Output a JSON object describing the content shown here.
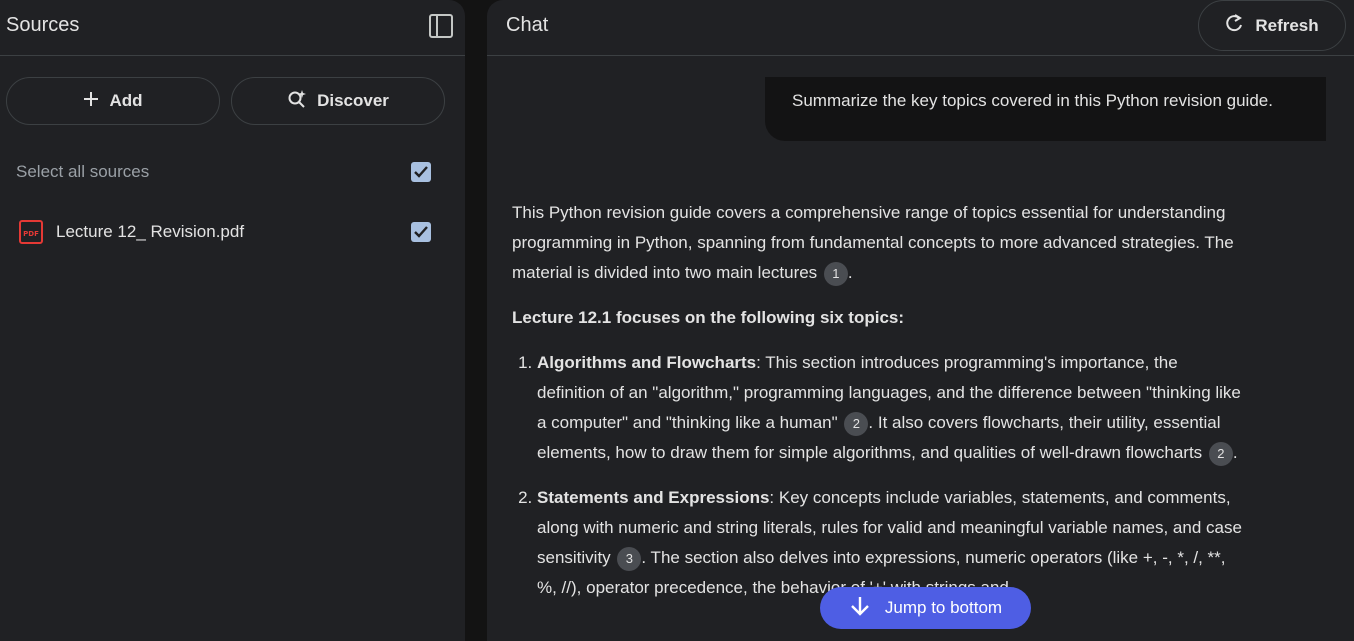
{
  "sources": {
    "title": "Sources",
    "add_label": "Add",
    "discover_label": "Discover",
    "select_all_label": "Select all sources",
    "select_all_checked": true,
    "items": [
      {
        "name": "Lecture 12_ Revision.pdf",
        "icon": "pdf-icon",
        "checked": true
      }
    ]
  },
  "chat": {
    "title": "Chat",
    "refresh_label": "Refresh",
    "user_message": "Summarize the key topics covered in this Python revision guide.",
    "intro": "This Python revision guide covers a comprehensive range of topics essential for understanding programming in Python, spanning from fundamental concepts to more advanced strategies. The material is divided into two main lectures",
    "intro_cite": "1",
    "intro_end": ".",
    "section_heading": "Lecture 12.1 focuses on the following six topics:",
    "items": [
      {
        "title": "Algorithms and Flowcharts",
        "text1": ": This section introduces programming's importance, the definition of an \"algorithm,\" programming languages, and the difference between \"thinking like a computer\" and \"thinking like a human\"",
        "cite1": "2",
        "text2": ". It also covers flowcharts, their utility, essential elements, how to draw them for simple algorithms, and qualities of well-drawn flowcharts",
        "cite2": "2",
        "text3": "."
      },
      {
        "title": "Statements and Expressions",
        "text1": ": Key concepts include variables, statements, and comments, along with numeric and string literals, rules for valid and meaningful variable names, and case sensitivity",
        "cite1": "3",
        "text2": ". The section also delves into expressions, numeric operators (like +, -, *, /, **, %, //), operator precedence, the behavior of '+' with strings and"
      }
    ],
    "jump_label": "Jump to bottom"
  },
  "colors": {
    "background": "#131313",
    "panel": "#202124",
    "accent": "#4e5ee4",
    "checkbox": "#a8c0e0",
    "pdf_red": "#e53935"
  }
}
